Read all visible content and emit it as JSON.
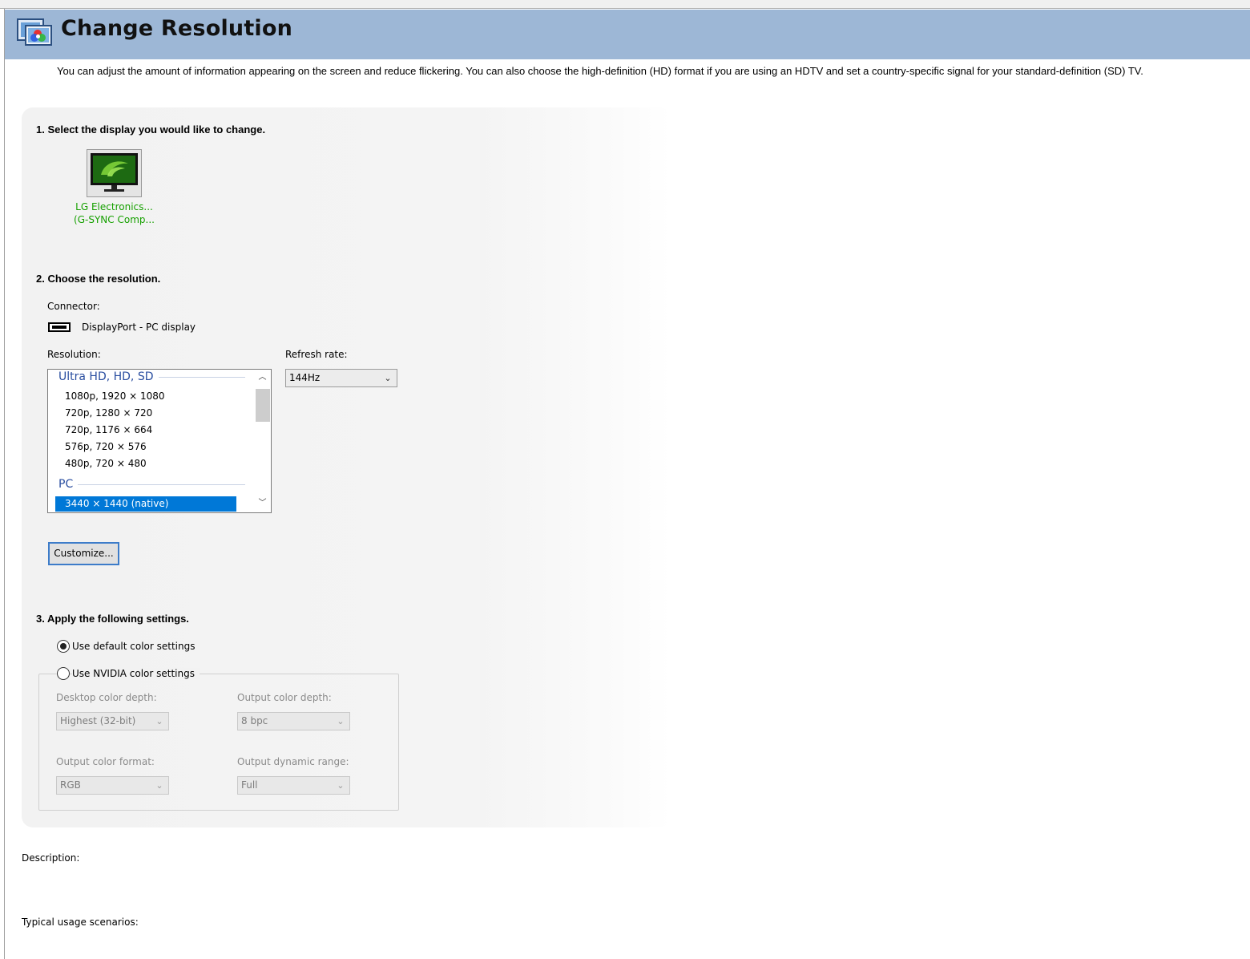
{
  "header": {
    "title": "Change Resolution"
  },
  "intro": "You can adjust the amount of information appearing on the screen and reduce flickering. You can also choose the high-definition (HD) format if you are using an HDTV and set a country-specific signal for your standard-definition (SD) TV.",
  "step1": {
    "title": "1. Select the display you would like to change.",
    "display_line1": "LG Electronics...",
    "display_line2": "(G-SYNC Comp..."
  },
  "step2": {
    "title": "2. Choose the resolution.",
    "connector_label": "Connector:",
    "connector_value": "DisplayPort - PC display",
    "resolution_label": "Resolution:",
    "refresh_label": "Refresh rate:",
    "refresh_value": "144Hz",
    "groups": [
      {
        "name": "Ultra HD, HD, SD",
        "items": [
          "1080p, 1920 × 1080",
          "720p, 1280 × 720",
          "720p, 1176 × 664",
          "576p, 720 × 576",
          "480p, 720 × 480"
        ]
      },
      {
        "name": "PC",
        "items": [
          "3440 × 1440 (native)"
        ]
      }
    ],
    "selected_resolution": "3440 × 1440 (native)",
    "customize_button": "Customize..."
  },
  "step3": {
    "title": "3. Apply the following settings.",
    "radio_default": "Use default color settings",
    "radio_nvidia": "Use NVIDIA color settings",
    "selected_option": "Use default color settings",
    "desktop_depth_label": "Desktop color depth:",
    "desktop_depth_value": "Highest (32-bit)",
    "output_depth_label": "Output color depth:",
    "output_depth_value": "8 bpc",
    "output_format_label": "Output color format:",
    "output_format_value": "RGB",
    "output_range_label": "Output dynamic range:",
    "output_range_value": "Full"
  },
  "footer": {
    "description_label": "Description:",
    "usage_label": "Typical usage scenarios:"
  },
  "colors": {
    "header_bg": "#9db7d6",
    "display_name": "#16a000",
    "group_heading": "#2a4ea0",
    "selection": "#0078d7",
    "button_border": "#3d7cc9"
  },
  "icons": {
    "header": "nvidia-display-settings-icon",
    "display": "nvidia-monitor-icon",
    "connector": "displayport-connector-icon"
  }
}
